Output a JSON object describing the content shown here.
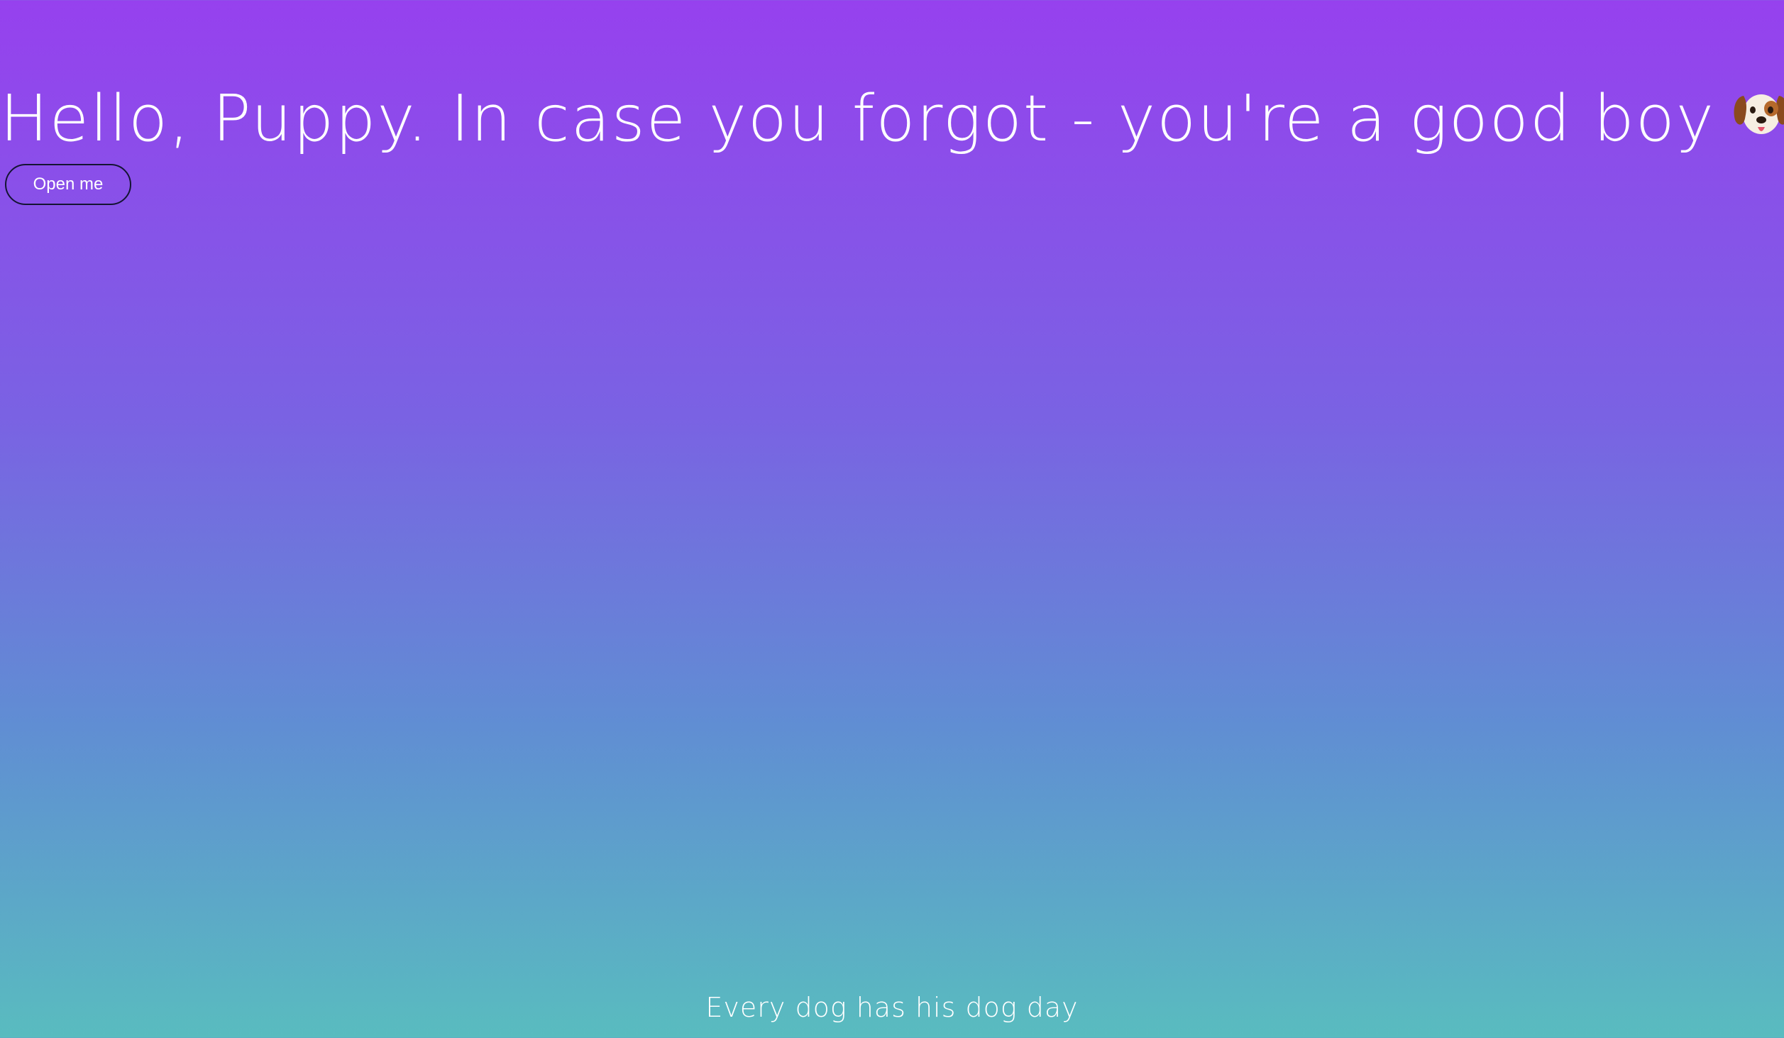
{
  "header": {
    "title": "Hello, Puppy. In case you forgot - you're a good boy",
    "icon": "dog-face-icon"
  },
  "actions": {
    "open_label": "Open me"
  },
  "footer": {
    "text": "Every dog has his dog day"
  },
  "colors": {
    "gradient_top": "#9641ee",
    "gradient_bottom": "#59bcbf",
    "text": "#ffffff",
    "button_border": "#141433"
  }
}
